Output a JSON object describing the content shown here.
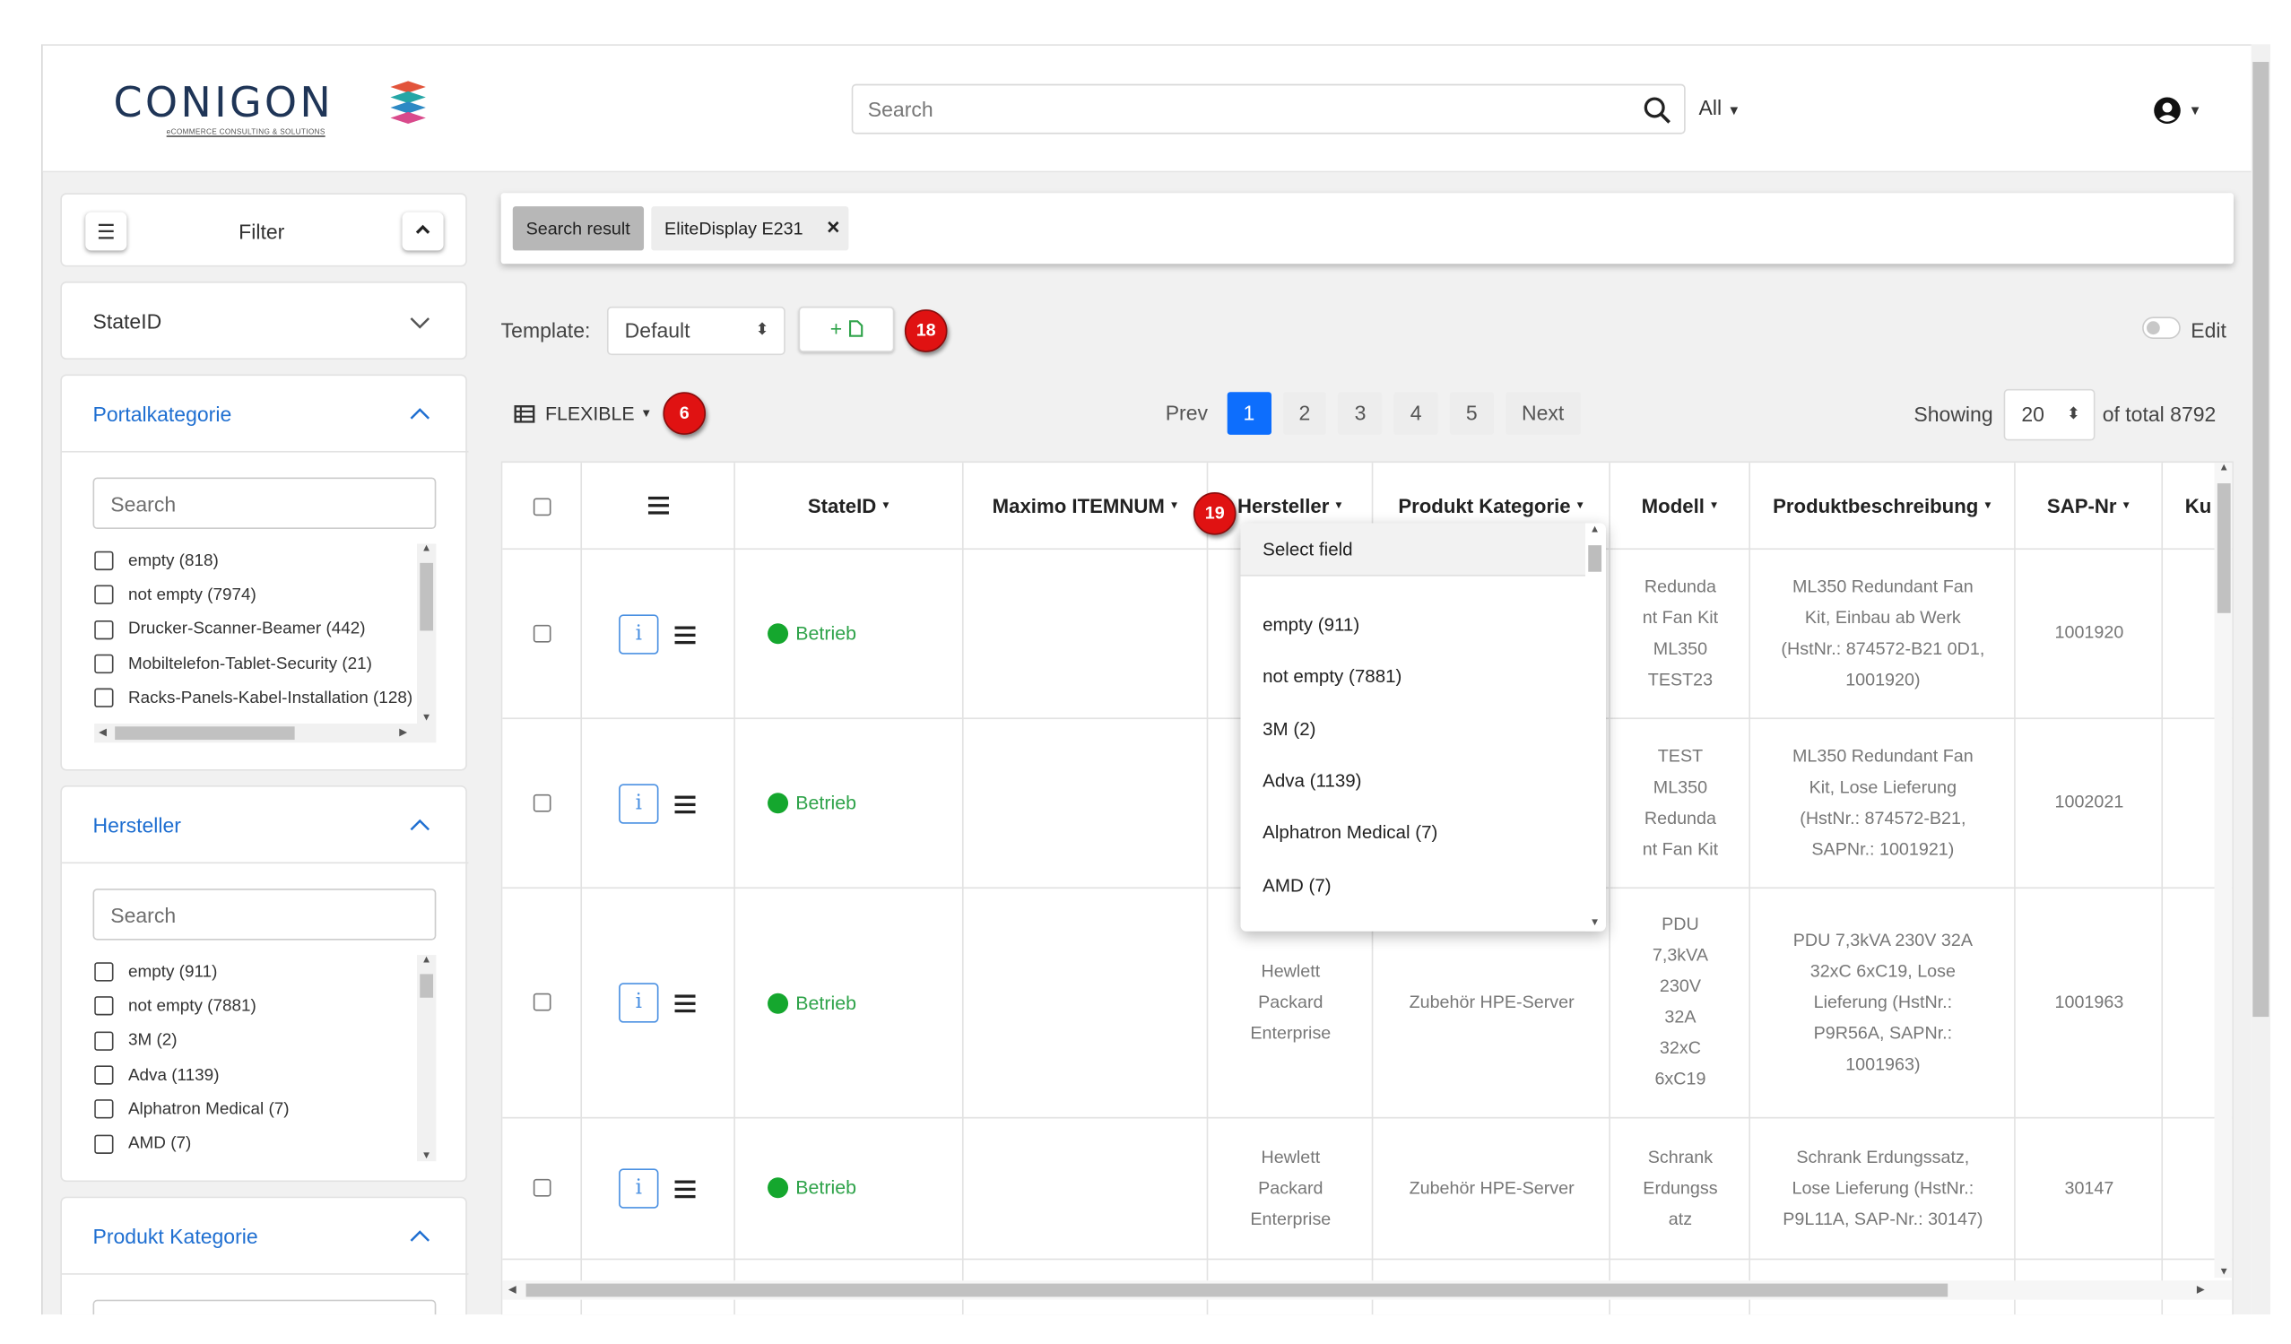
{
  "header": {
    "logo_text": "CONIGON",
    "logo_subtitle": "eCOMMERCE CONSULTING & SOLUTIONS",
    "search_placeholder": "Search",
    "scope_label": "All"
  },
  "sidebar": {
    "filter_title": "Filter",
    "facets": [
      {
        "title": "StateID",
        "expanded": false
      },
      {
        "title": "Portalkategorie",
        "expanded": true,
        "search_placeholder": "Search",
        "items": [
          "empty (818)",
          "not empty (7974)",
          "Drucker-Scanner-Beamer (442)",
          "Mobiltelefon-Tablet-Security (21)",
          "Racks-Panels-Kabel-Installation (128)"
        ]
      },
      {
        "title": "Hersteller",
        "expanded": true,
        "search_placeholder": "Search",
        "items": [
          "empty (911)",
          "not empty (7881)",
          "3M (2)",
          "Adva (1139)",
          "Alphatron Medical (7)",
          "AMD (7)"
        ]
      },
      {
        "title": "Produkt Kategorie",
        "expanded": true
      }
    ]
  },
  "search_result": {
    "label": "Search result",
    "query_chip": "EliteDisplay E231"
  },
  "toolbar": {
    "template_label": "Template:",
    "template_value": "Default",
    "add_label": "+",
    "badge_18": "18",
    "edit_label": "Edit",
    "view_mode": "FLEXIBLE",
    "badge_6": "6",
    "prev_label": "Prev",
    "next_label": "Next",
    "pages": [
      "1",
      "2",
      "3",
      "4",
      "5"
    ],
    "active_page": "1",
    "showing_label": "Showing",
    "page_size": "20",
    "total_label": "of total 8792"
  },
  "table": {
    "columns": [
      "StateID",
      "Maximo ITEMNUM",
      "Hersteller",
      "Produkt Kategorie",
      "Modell",
      "Produktbeschreibung",
      "SAP-Nr",
      "Ku"
    ],
    "badge_19": "19",
    "rows": [
      {
        "state": "Betrieb",
        "maximo": "",
        "hersteller": "",
        "kategorie": "",
        "modell": "Redunda\nnt Fan Kit\nML350\nTEST23",
        "beschreibung": "ML350 Redundant Fan\nKit, Einbau ab Werk\n(HstNr.: 874572-B21 0D1,\n1001920)",
        "sap": "1001920"
      },
      {
        "state": "Betrieb",
        "maximo": "",
        "hersteller": "",
        "kategorie": "",
        "modell": "TEST\nML350\nRedunda\nnt Fan Kit",
        "beschreibung": "ML350 Redundant Fan\nKit, Lose Lieferung\n(HstNr.: 874572-B21,\nSAPNr.: 1001921)",
        "sap": "1002021"
      },
      {
        "state": "Betrieb",
        "maximo": "",
        "hersteller": "Hewlett\nPackard\nEnterprise",
        "kategorie": "Zubehör HPE-Server",
        "modell": "PDU\n7,3kVA\n230V\n32A\n32xC\n6xC19",
        "beschreibung": "PDU 7,3kVA 230V 32A\n32xC 6xC19, Lose\nLieferung (HstNr.:\nP9R56A, SAPNr.:\n1001963)",
        "sap": "1001963"
      },
      {
        "state": "Betrieb",
        "maximo": "",
        "hersteller": "Hewlett\nPackard\nEnterprise",
        "kategorie": "Zubehör HPE-Server",
        "modell": "Schrank\nErdungss\natz",
        "beschreibung": "Schrank Erdungssatz,\nLose Lieferung (HstNr.:\nP9L11A, SAP-Nr.: 30147)",
        "sap": "30147"
      }
    ]
  },
  "hersteller_dropdown": {
    "header": "Select field",
    "options": [
      "empty (911)",
      "not empty (7881)",
      "3M (2)",
      "Adva (1139)",
      "Alphatron Medical (7)",
      "AMD (7)"
    ]
  },
  "colors": {
    "primary": "#0d6efd",
    "status_green": "#15a72e",
    "badge_red": "#e01212",
    "logo_navy": "#1f3557"
  }
}
